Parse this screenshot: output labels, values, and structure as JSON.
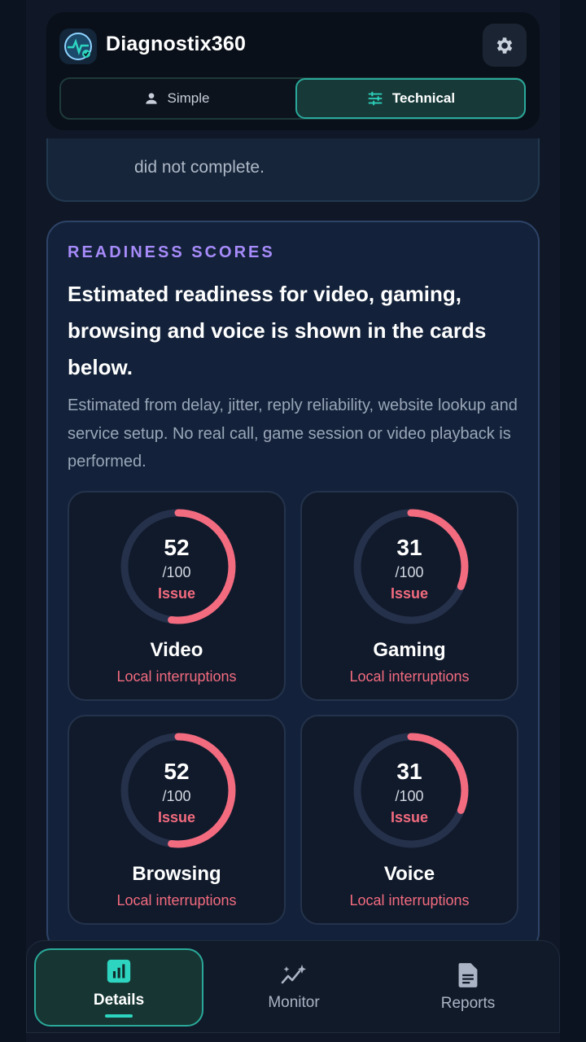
{
  "app": {
    "title": "Diagnostix360"
  },
  "mode_toggle": {
    "simple_label": "Simple",
    "technical_label": "Technical",
    "selected": "Technical"
  },
  "previous_card": {
    "text": "did not complete."
  },
  "readiness": {
    "eyebrow": "READINESS SCORES",
    "headline": "Estimated readiness for video, gaming, browsing and voice is shown in the cards below.",
    "description": "Estimated from delay, jitter, reply reliability, website lookup and service setup. No real call, game session or video playback is performed.",
    "cards": [
      {
        "title": "Video",
        "score": "52",
        "max": "/100",
        "status": "Issue",
        "note": "Local interruptions",
        "fraction": 0.52
      },
      {
        "title": "Gaming",
        "score": "31",
        "max": "/100",
        "status": "Issue",
        "note": "Local interruptions",
        "fraction": 0.31
      },
      {
        "title": "Browsing",
        "score": "52",
        "max": "/100",
        "status": "Issue",
        "note": "Local interruptions",
        "fraction": 0.52
      },
      {
        "title": "Voice",
        "score": "31",
        "max": "/100",
        "status": "Issue",
        "note": "Local interruptions",
        "fraction": 0.31
      }
    ]
  },
  "bottom_nav": {
    "items": [
      {
        "label": "Details",
        "icon": "bar-chart-icon",
        "active": true
      },
      {
        "label": "Monitor",
        "icon": "activity-sparkle-icon",
        "active": false
      },
      {
        "label": "Reports",
        "icon": "document-icon",
        "active": false
      }
    ]
  },
  "colors": {
    "accent": "#2dd4bf",
    "issue": "#f36b7f",
    "eyebrow": "#a78bfa",
    "ring_track": "#25304a"
  }
}
